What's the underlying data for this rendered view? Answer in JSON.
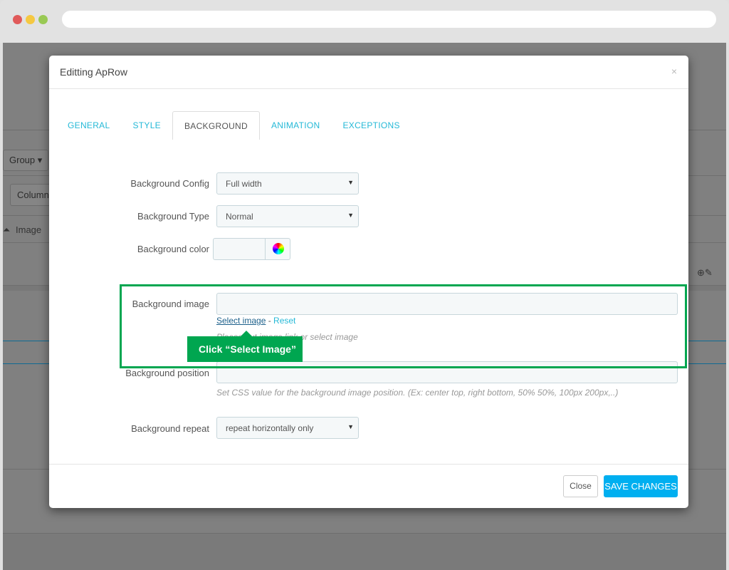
{
  "browser": {
    "dots": [
      "#e05a5a",
      "#f5c842",
      "#99c954"
    ]
  },
  "background_page": {
    "group_btn": "Group ▾",
    "column_btn": "Column",
    "image_label": "Image"
  },
  "modal": {
    "title": "Editting ApRow",
    "close_icon": "×",
    "tabs": [
      {
        "label": "GENERAL"
      },
      {
        "label": "STYLE"
      },
      {
        "label": "BACKGROUND",
        "active": true
      },
      {
        "label": "ANIMATION"
      },
      {
        "label": "EXCEPTIONS"
      }
    ],
    "fields": {
      "config": {
        "label": "Background Config",
        "value": "Full width"
      },
      "type": {
        "label": "Background Type",
        "value": "Normal"
      },
      "color": {
        "label": "Background color",
        "value": "",
        "icon": "color-wheel-icon"
      },
      "image": {
        "label": "Background image",
        "value": "",
        "select_link": "Select image",
        "separator": " - ",
        "reset_link": "Reset",
        "help": "Please put image link or select image"
      },
      "position": {
        "label": "Background position",
        "value": "",
        "help": "Set CSS value for the background image position. (Ex: center top, right bottom, 50% 50%, 100px 200px,..)"
      },
      "repeat": {
        "label": "Background repeat",
        "value": "repeat horizontally only"
      }
    },
    "footer": {
      "close": "Close",
      "save": "SAVE CHANGES"
    }
  },
  "annotation": {
    "text": "Click “Select Image”",
    "color": "#00a650"
  },
  "colors": {
    "accent": "#25b9d7",
    "save_button": "#00aff0"
  }
}
